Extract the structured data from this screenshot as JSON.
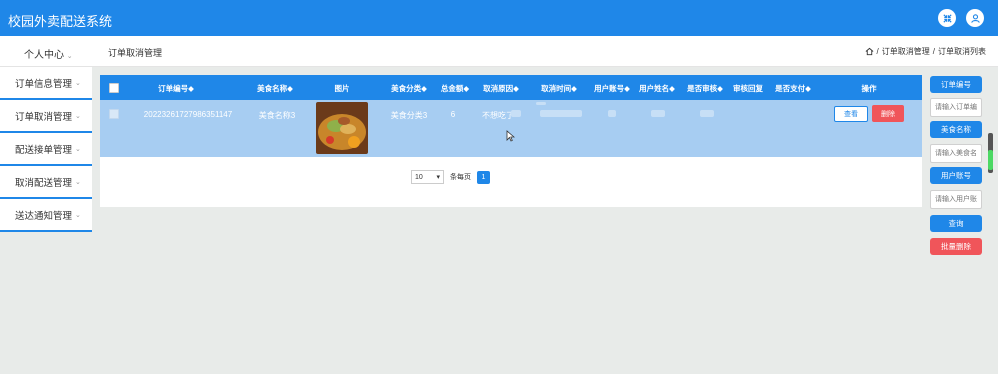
{
  "app": {
    "title": "校园外卖配送系统",
    "icons": {
      "fullscreen": "arrows-collapse-icon",
      "user": "user-icon"
    }
  },
  "subbar": {
    "user_center": "个人中心",
    "page_heading": "订单取消管理",
    "breadcrumb": [
      "订单取消管理",
      "订单取消列表"
    ]
  },
  "sidebar": {
    "items": [
      {
        "label": "订单信息管理"
      },
      {
        "label": "订单取消管理"
      },
      {
        "label": "配送接单管理"
      },
      {
        "label": "取消配送管理"
      },
      {
        "label": "送达通知管理"
      }
    ]
  },
  "table": {
    "headers": [
      "订单编号◆",
      "美食名称◆",
      "图片",
      "美食分类◆",
      "总金额◆",
      "取消原因◆",
      "取消时间◆",
      "用户账号◆",
      "用户姓名◆",
      "是否审核◆",
      "审核回复",
      "是否支付◆",
      "操作"
    ],
    "rows": [
      {
        "order_no": "20223261727986351147",
        "food_name": "美食名称3",
        "category": "美食分类3",
        "amount": "6",
        "reason": "不想吃了",
        "view_label": "查看",
        "delete_label": "删除"
      }
    ]
  },
  "pager": {
    "page_size": "10",
    "per_page_label": "条每页",
    "current_page": "1"
  },
  "right_panel": {
    "order_no_label": "订单编号",
    "order_no_placeholder": "请输入订单编号",
    "food_name_label": "美食名称",
    "food_name_placeholder": "请输入美食名称",
    "user_account_label": "用户账号",
    "user_account_placeholder": "请输入用户账号",
    "search_label": "查询",
    "batch_delete_label": "批量删除"
  },
  "colors": {
    "primary": "#1f87e8",
    "danger": "#f0555a",
    "row_selected": "#a7cdf2"
  }
}
